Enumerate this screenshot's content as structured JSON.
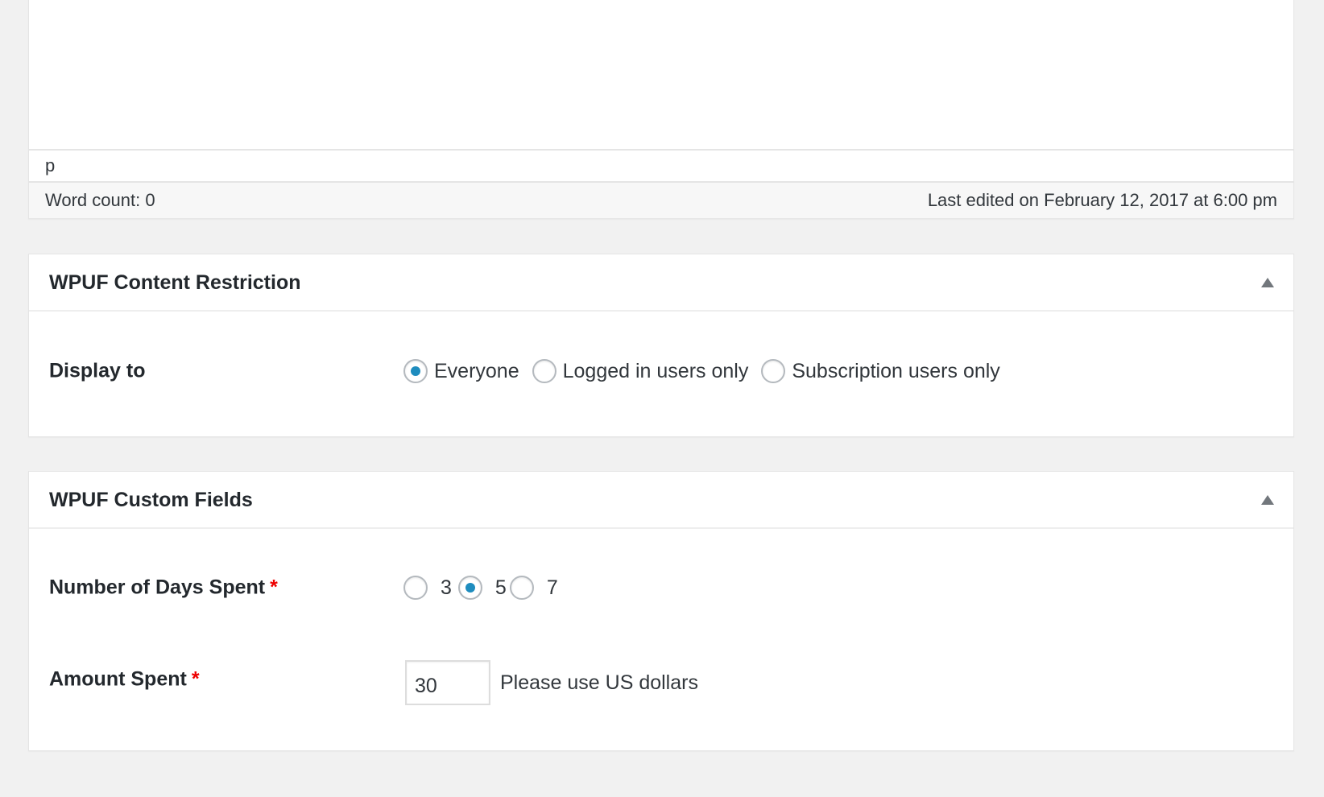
{
  "editor": {
    "path": "p",
    "word_count": "Word count: 0",
    "last_edited": "Last edited on February 12, 2017 at 6:00 pm"
  },
  "restriction_panel": {
    "title": "WPUF Content Restriction",
    "toggle_icon": "triangle-up-icon",
    "display_to": {
      "label": "Display to",
      "options": [
        {
          "label": "Everyone",
          "checked": true
        },
        {
          "label": "Logged in users only",
          "checked": false
        },
        {
          "label": "Subscription users only",
          "checked": false
        }
      ]
    }
  },
  "custom_fields_panel": {
    "title": "WPUF Custom Fields",
    "toggle_icon": "triangle-up-icon",
    "days_spent": {
      "label": "Number of Days Spent",
      "required_mark": "*",
      "options": [
        {
          "label": "3",
          "checked": false
        },
        {
          "label": "5",
          "checked": true
        },
        {
          "label": "7",
          "checked": false
        }
      ]
    },
    "amount_spent": {
      "label": "Amount Spent",
      "required_mark": "*",
      "value": "30",
      "help": "Please use US dollars"
    }
  },
  "colors": {
    "background": "#f1f1f1",
    "accent": "#1e8cbe",
    "required": "#ee0000"
  }
}
